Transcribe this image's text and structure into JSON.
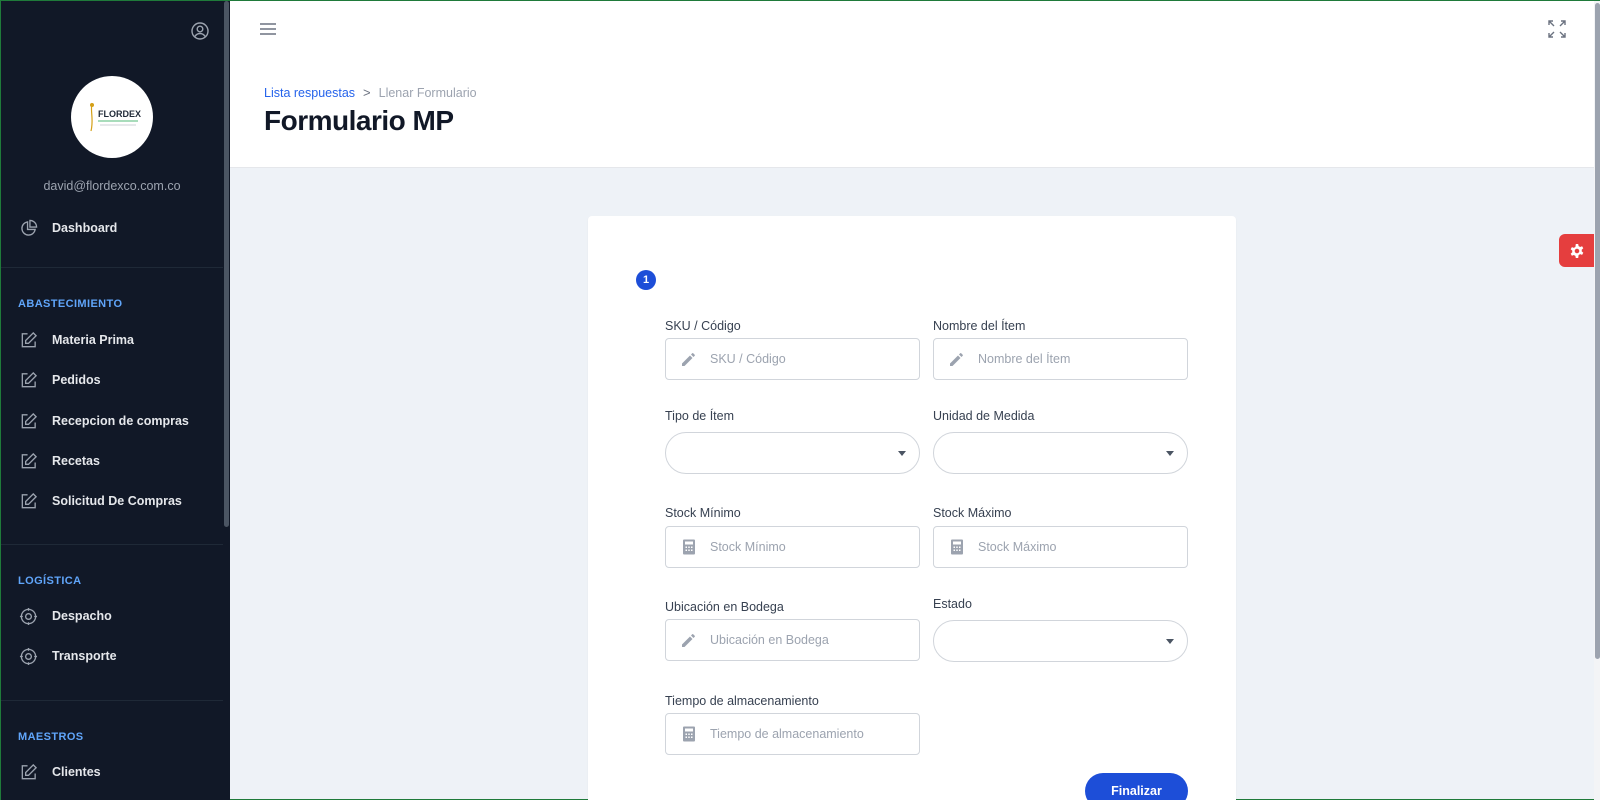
{
  "sidebar": {
    "email": "david@flordexco.com.co",
    "logo_text": "FLORDEX",
    "dashboard": "Dashboard",
    "sections": [
      {
        "title": "ABASTECIMIENTO",
        "items": [
          "Materia Prima",
          "Pedidos",
          "Recepcion de compras",
          "Recetas",
          "Solicitud De Compras"
        ]
      },
      {
        "title": "LOGÍSTICA",
        "items": [
          "Despacho",
          "Transporte"
        ]
      },
      {
        "title": "MAESTROS",
        "items": [
          "Clientes"
        ]
      }
    ]
  },
  "header": {
    "breadcrumb_link": "Lista respuestas",
    "breadcrumb_sep": ">",
    "breadcrumb_current": "Llenar Formulario",
    "title": "Formulario MP"
  },
  "form": {
    "step": "1",
    "sku": {
      "label": "SKU / Código",
      "placeholder": "SKU / Código",
      "value": ""
    },
    "nombre": {
      "label": "Nombre del Ítem",
      "placeholder": "Nombre del Ítem",
      "value": ""
    },
    "tipo": {
      "label": "Tipo de Ítem",
      "value": ""
    },
    "unidad": {
      "label": "Unidad de Medida",
      "value": ""
    },
    "stock_min": {
      "label": "Stock Mínimo",
      "placeholder": "Stock Mínimo",
      "value": ""
    },
    "stock_max": {
      "label": "Stock Máximo",
      "placeholder": "Stock Máximo",
      "value": ""
    },
    "ubicacion": {
      "label": "Ubicación en Bodega",
      "placeholder": "Ubicación en Bodega",
      "value": ""
    },
    "estado": {
      "label": "Estado",
      "value": ""
    },
    "tiempo": {
      "label": "Tiempo de almacenamiento",
      "placeholder": "Tiempo de almacenamiento",
      "value": ""
    },
    "submit_label": "Finalizar"
  },
  "colors": {
    "sidebar_bg": "#111827",
    "accent": "#1d4ed8",
    "section_title": "#60a5fa",
    "settings_button": "#e53e3e"
  },
  "icons": {
    "user": "user-circle-icon",
    "dashboard": "pie-chart-icon",
    "edit": "edit-square-icon",
    "logistics": "cog-icon",
    "menu": "hamburger-icon",
    "expand": "fullscreen-icon",
    "settings": "gear-icon",
    "pencil": "pencil-icon",
    "calculator": "calculator-icon"
  }
}
